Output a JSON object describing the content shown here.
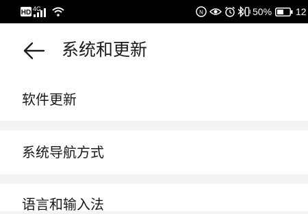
{
  "status_bar": {
    "network_hd": "HD",
    "network_gen": "4G",
    "battery_percent": "50%",
    "time": "12",
    "icons": [
      "hd-icon",
      "signal-icon",
      "wifi-icon",
      "nfc-icon",
      "eye-icon",
      "alarm-icon",
      "bluetooth-icon",
      "vibrate-icon",
      "battery-icon"
    ]
  },
  "header": {
    "title": "系统和更新",
    "back_icon": "arrow-left-icon"
  },
  "settings": {
    "items": [
      {
        "label": "软件更新"
      },
      {
        "label": "系统导航方式"
      },
      {
        "label": "语言和输入法"
      }
    ]
  },
  "colors": {
    "background": "#f1f3f5",
    "card": "#ffffff",
    "text": "#1a1a1a",
    "status_bar": "#000000"
  }
}
